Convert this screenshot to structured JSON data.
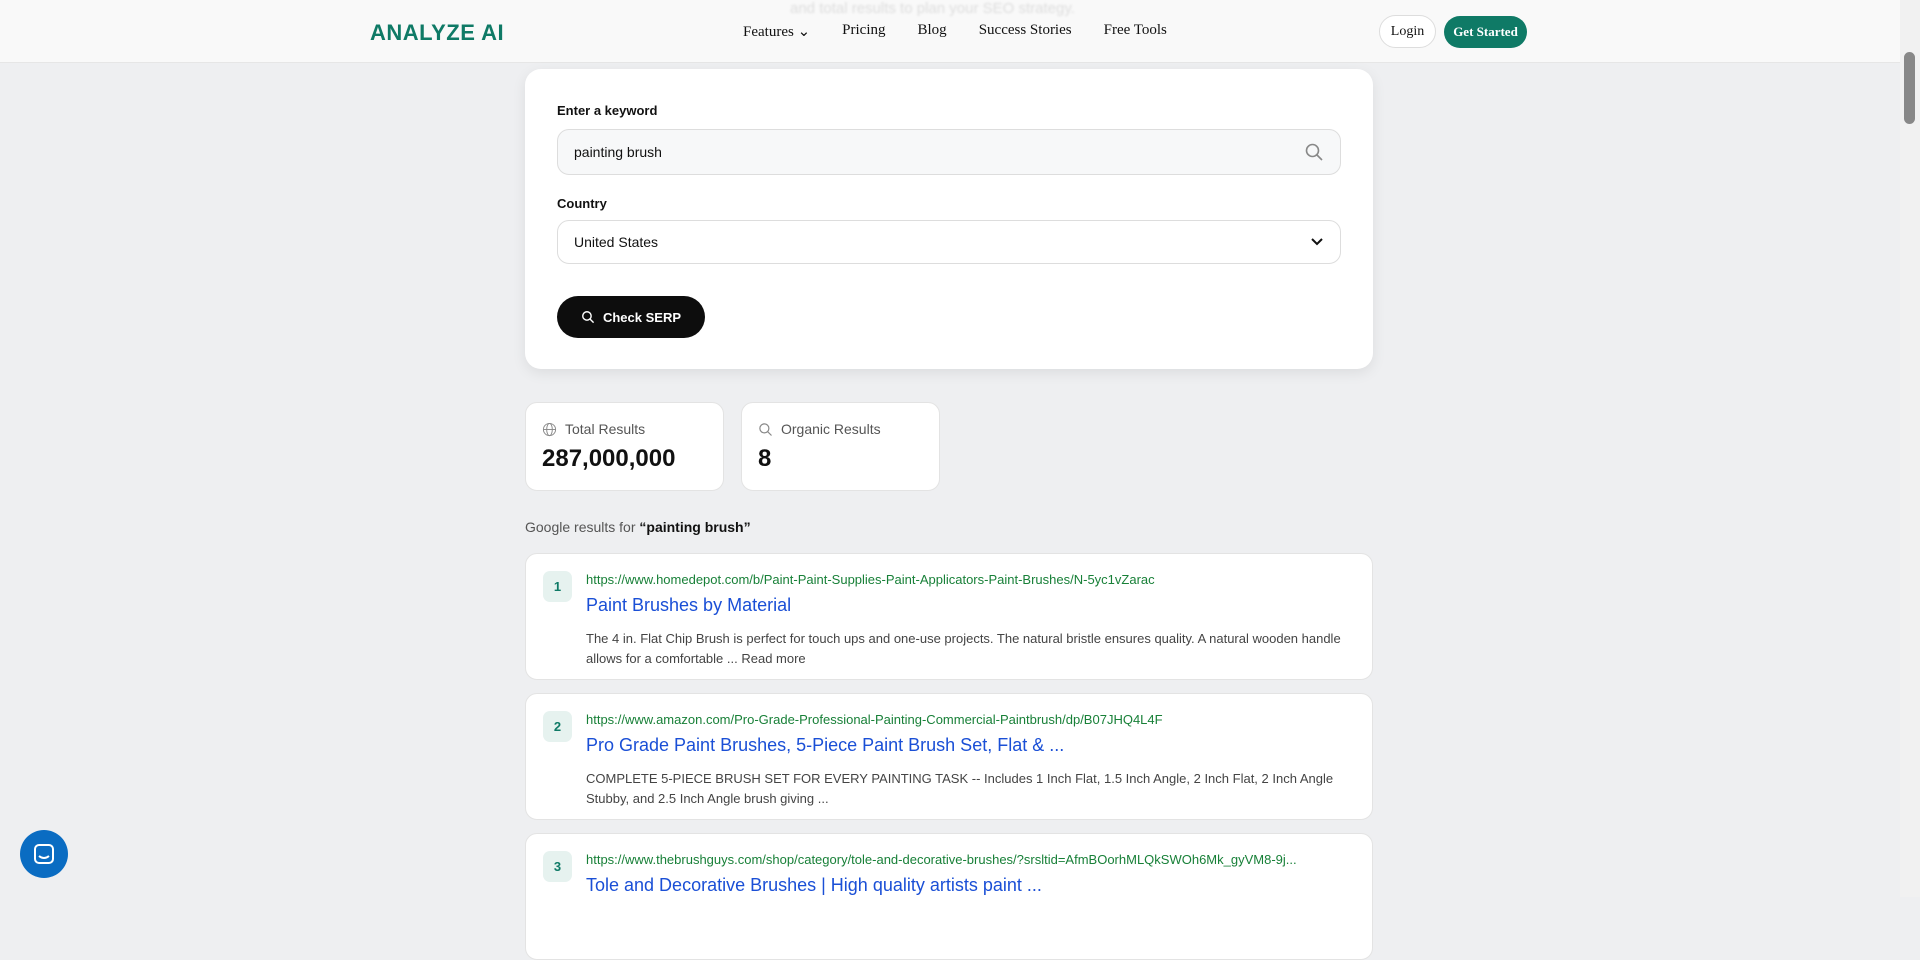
{
  "nav": {
    "ghost_text": "and total results to plan your SEO strategy.",
    "logo": "ANALYZE AI",
    "items": [
      "Features",
      "Pricing",
      "Blog",
      "Success Stories",
      "Free Tools"
    ],
    "login": "Login",
    "get_started": "Get Started"
  },
  "form": {
    "keyword_label": "Enter a keyword",
    "keyword_value": "painting brush",
    "country_label": "Country",
    "country_value": "United States",
    "submit": "Check SERP"
  },
  "stats": [
    {
      "label": "Total Results",
      "value": "287,000,000",
      "icon": "globe-icon"
    },
    {
      "label": "Organic Results",
      "value": "8",
      "icon": "search-icon"
    }
  ],
  "results_heading": {
    "prefix": "Google results for",
    "query": "“painting brush”"
  },
  "results": [
    {
      "rank": "1",
      "url": "https://www.homedepot.com/b/Paint-Paint-Supplies-Paint-Applicators-Paint-Brushes/N-5yc1vZarac",
      "title": "Paint Brushes by Material",
      "snippet": "The 4 in. Flat Chip Brush is perfect for touch ups and one-use projects. The natural bristle ensures quality. A natural wooden handle allows for a comfortable ... Read more"
    },
    {
      "rank": "2",
      "url": "https://www.amazon.com/Pro-Grade-Professional-Painting-Commercial-Paintbrush/dp/B07JHQ4L4F",
      "title": "Pro Grade Paint Brushes, 5-Piece Paint Brush Set, Flat & ...",
      "snippet": "COMPLETE 5-PIECE BRUSH SET FOR EVERY PAINTING TASK -- Includes 1 Inch Flat, 1.5 Inch Angle, 2 Inch Flat, 2 Inch Angle Stubby, and 2.5 Inch Angle brush giving ..."
    },
    {
      "rank": "3",
      "url": "https://www.thebrushguys.com/shop/category/tole-and-decorative-brushes/?srsltid=AfmBOorhMLQkSWOh6Mk_gyVM8-9j...",
      "title": "Tole and Decorative Brushes | High quality artists paint ...",
      "snippet": ""
    }
  ]
}
